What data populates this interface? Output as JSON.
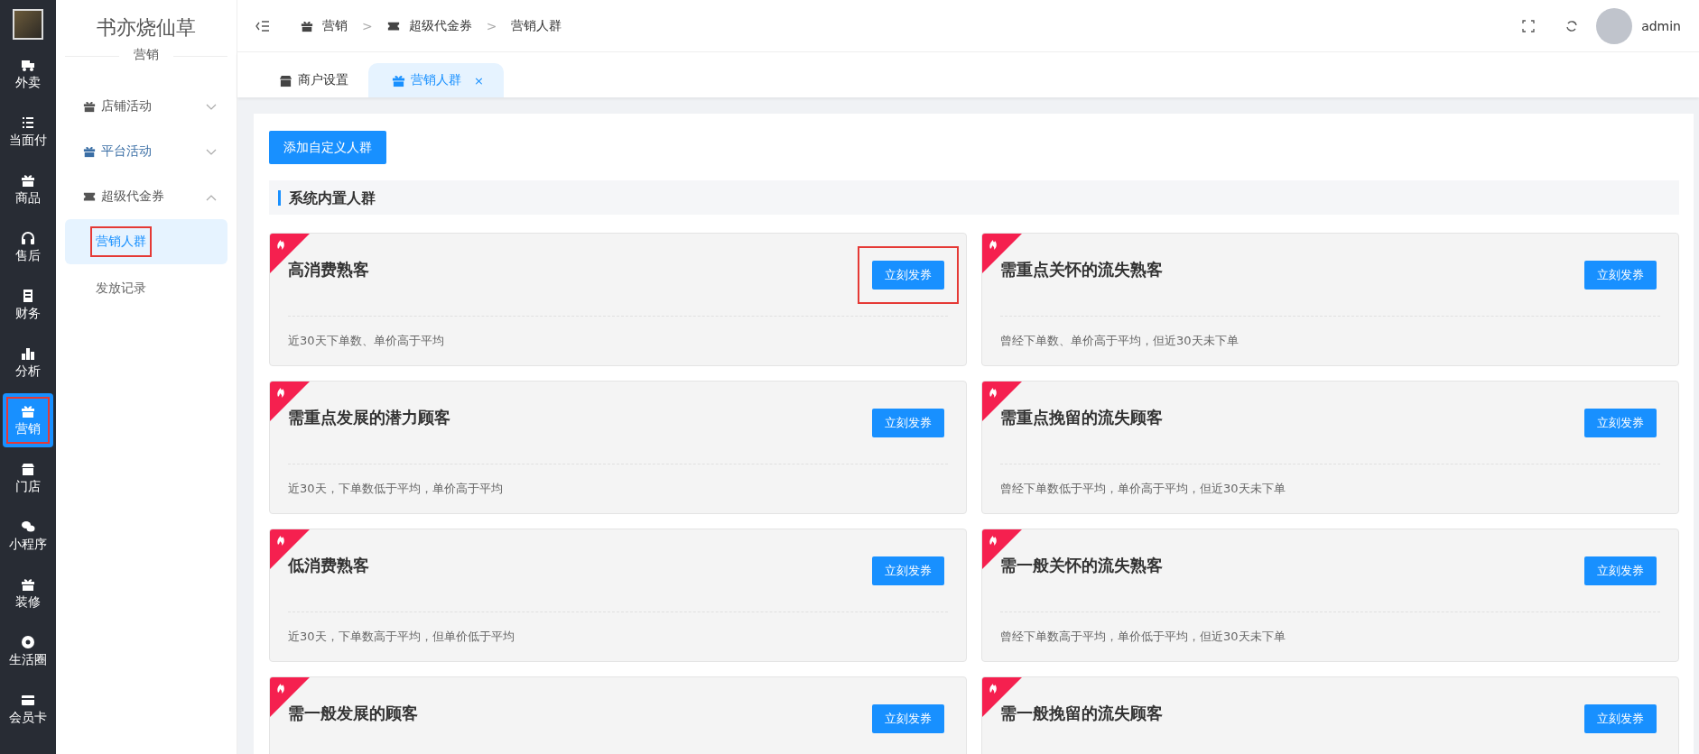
{
  "rail": [
    {
      "label": "外卖",
      "selected": false,
      "annotated": false
    },
    {
      "label": "当面付",
      "selected": false,
      "annotated": false
    },
    {
      "label": "商品",
      "selected": false,
      "annotated": false
    },
    {
      "label": "售后",
      "selected": false,
      "annotated": false
    },
    {
      "label": "财务",
      "selected": false,
      "annotated": false
    },
    {
      "label": "分析",
      "selected": false,
      "annotated": false
    },
    {
      "label": "营销",
      "selected": true,
      "annotated": true
    },
    {
      "label": "门店",
      "selected": false,
      "annotated": false
    },
    {
      "label": "小程序",
      "selected": false,
      "annotated": false
    },
    {
      "label": "装修",
      "selected": false,
      "annotated": false
    },
    {
      "label": "生活圈",
      "selected": false,
      "annotated": false
    },
    {
      "label": "会员卡",
      "selected": false,
      "annotated": false
    }
  ],
  "sidebar": {
    "title": "书亦烧仙草",
    "subtitle": "营销",
    "groups": [
      {
        "label": "店铺活动",
        "expanded": false,
        "highlighted": false
      },
      {
        "label": "平台活动",
        "expanded": false,
        "highlighted": true
      },
      {
        "label": "超级代金券",
        "expanded": true,
        "highlighted": false,
        "children": [
          {
            "label": "营销人群",
            "selected": true,
            "annotated": true
          },
          {
            "label": "发放记录",
            "selected": false,
            "annotated": false
          }
        ]
      }
    ]
  },
  "breadcrumb": [
    {
      "label": "营销"
    },
    {
      "label": "超级代金券"
    },
    {
      "label": "营销人群"
    }
  ],
  "separator": ">",
  "user": {
    "name": "admin"
  },
  "tabs": [
    {
      "label": "商户设置",
      "selected": false
    },
    {
      "label": "营销人群",
      "selected": true,
      "close": "×"
    }
  ],
  "add_button": "添加自定义人群",
  "section_title": "系统内置人群",
  "cards": [
    {
      "title": "高消费熟客",
      "button": "立刻发券",
      "button_annotated": true,
      "description": "近30天下单数、单价高于平均"
    },
    {
      "title": "需重点关怀的流失熟客",
      "button": "立刻发券",
      "button_annotated": false,
      "description": "曾经下单数、单价高于平均，但近30天未下单"
    },
    {
      "title": "需重点发展的潜力顾客",
      "button": "立刻发券",
      "button_annotated": false,
      "description": "近30天，下单数低于平均，单价高于平均"
    },
    {
      "title": "需重点挽留的流失顾客",
      "button": "立刻发券",
      "button_annotated": false,
      "description": "曾经下单数低于平均，单价高于平均，但近30天未下单"
    },
    {
      "title": "低消费熟客",
      "button": "立刻发券",
      "button_annotated": false,
      "description": "近30天，下单数高于平均，但单价低于平均"
    },
    {
      "title": "需一般关怀的流失熟客",
      "button": "立刻发券",
      "button_annotated": false,
      "description": "曾经下单数高于平均，单价低于平均，但近30天未下单"
    },
    {
      "title": "需一般发展的顾客",
      "button": "立刻发券",
      "button_annotated": false
    },
    {
      "title": "需一般挽留的流失顾客",
      "button": "立刻发券",
      "button_annotated": false
    }
  ]
}
